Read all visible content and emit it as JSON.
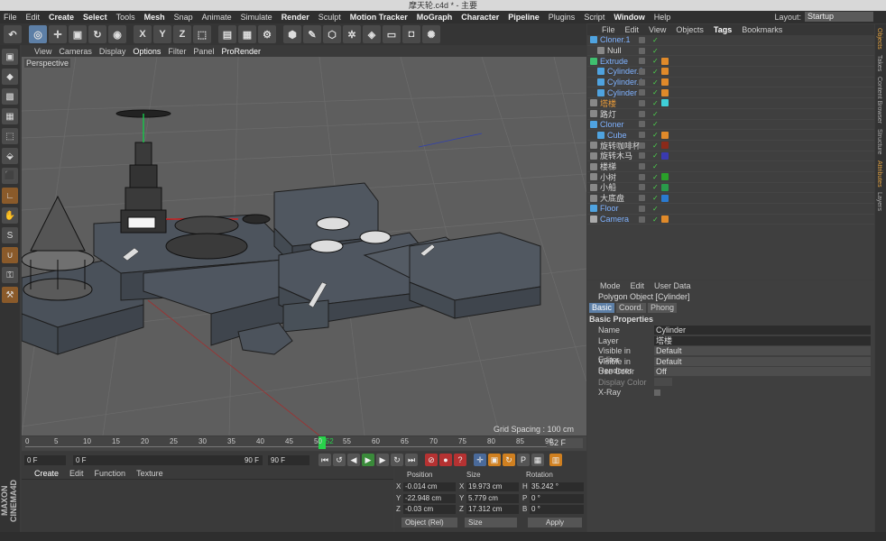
{
  "window": {
    "title": "摩天轮.c4d * - 主要"
  },
  "menu": [
    "File",
    "Edit",
    "Create",
    "Select",
    "Tools",
    "Mesh",
    "Snap",
    "Animate",
    "Simulate",
    "Render",
    "Sculpt",
    "Motion Tracker",
    "MoGraph",
    "Character",
    "Pipeline",
    "Plugins",
    "Script",
    "Window",
    "Help"
  ],
  "layout": {
    "label": "Layout:",
    "value": "Startup"
  },
  "toolbar": {
    "undo_icon": "undo-icon",
    "axis": [
      "X",
      "Y",
      "Z"
    ]
  },
  "viewport": {
    "menu": [
      "View",
      "Cameras",
      "Display",
      "Options",
      "Filter",
      "Panel",
      "ProRender"
    ],
    "label": "Perspective",
    "grid_spacing": "Grid Spacing : 100 cm"
  },
  "timeline": {
    "ticks": [
      "0",
      "5",
      "10",
      "15",
      "20",
      "25",
      "30",
      "35",
      "40",
      "45",
      "50",
      "52",
      "55",
      "60",
      "65",
      "70",
      "75",
      "80",
      "85",
      "90"
    ],
    "current_frame": 52,
    "max_frame": 90,
    "frame_display": "52 F"
  },
  "transport": {
    "start": "0 F",
    "range_start": "0 F",
    "range_end": "90 F",
    "end": "90 F"
  },
  "material": {
    "menu": [
      "Create",
      "Edit",
      "Function",
      "Texture"
    ]
  },
  "coordinates": {
    "headers": [
      "Position",
      "Size",
      "Rotation"
    ],
    "rows": [
      {
        "axis": "X",
        "pos": "-0.014 cm",
        "size_axis": "X",
        "size": "19.973 cm",
        "rot_axis": "H",
        "rot": "35.242 °"
      },
      {
        "axis": "Y",
        "pos": "-22.948 cm",
        "size_axis": "Y",
        "size": "5.779 cm",
        "rot_axis": "P",
        "rot": "0 °"
      },
      {
        "axis": "Z",
        "pos": "-0.03 cm",
        "size_axis": "Z",
        "size": "17.312 cm",
        "rot_axis": "B",
        "rot": "0 °"
      }
    ],
    "mode": "Object (Rel)",
    "size_mode": "Size",
    "apply": "Apply"
  },
  "objects": {
    "menu": [
      "File",
      "Edit",
      "View",
      "Objects",
      "Tags",
      "Bookmarks"
    ],
    "items": [
      {
        "name": "Cloner.1",
        "indent": 0,
        "color": "blue",
        "icon": "#4fa3e0",
        "tag": ""
      },
      {
        "name": "Null",
        "indent": 1,
        "color": "white",
        "icon": "#888888",
        "tag": ""
      },
      {
        "name": "Extrude",
        "indent": 0,
        "color": "blue",
        "icon": "#3fbf6f",
        "tag": "#e08a2a"
      },
      {
        "name": "Cylinder.2",
        "indent": 1,
        "color": "blue",
        "icon": "#4fa3e0",
        "tag": "#e08a2a"
      },
      {
        "name": "Cylinder.1",
        "indent": 1,
        "color": "blue",
        "icon": "#4fa3e0",
        "tag": "#e08a2a"
      },
      {
        "name": "Cylinder",
        "indent": 1,
        "color": "blue",
        "icon": "#4fa3e0",
        "tag": "#e08a2a"
      },
      {
        "name": "塔楼",
        "indent": 0,
        "color": "orange",
        "icon": "#888888",
        "tag": "#3fd0d8"
      },
      {
        "name": "路灯",
        "indent": 0,
        "color": "white",
        "icon": "#888888",
        "tag": ""
      },
      {
        "name": "Cloner",
        "indent": 0,
        "color": "blue",
        "icon": "#4fa3e0",
        "tag": ""
      },
      {
        "name": "Cube",
        "indent": 1,
        "color": "blue",
        "icon": "#4fa3e0",
        "tag": "#e08a2a"
      },
      {
        "name": "旋转咖啡杯",
        "indent": 0,
        "color": "white",
        "icon": "#888888",
        "tag": "#8a2a1a"
      },
      {
        "name": "旋转木马",
        "indent": 0,
        "color": "white",
        "icon": "#888888",
        "tag": "#3a3ab0"
      },
      {
        "name": "楼梯",
        "indent": 0,
        "color": "white",
        "icon": "#888888",
        "tag": ""
      },
      {
        "name": "小树",
        "indent": 0,
        "color": "white",
        "icon": "#888888",
        "tag": "#2aa02a"
      },
      {
        "name": "小船",
        "indent": 0,
        "color": "white",
        "icon": "#888888",
        "tag": "#2a9a4a"
      },
      {
        "name": "大底盘",
        "indent": 0,
        "color": "white",
        "icon": "#888888",
        "tag": "#2a7ad0"
      },
      {
        "name": "Floor",
        "indent": 0,
        "color": "blue",
        "icon": "#4fa3e0",
        "tag": ""
      },
      {
        "name": "Camera",
        "indent": 0,
        "color": "blue",
        "icon": "#aaaaaa",
        "tag": "#e08a2a"
      }
    ]
  },
  "attributes": {
    "menu": [
      "Mode",
      "Edit",
      "User Data"
    ],
    "title": "Polygon Object [Cylinder]",
    "tabs": [
      "Basic",
      "Coord.",
      "Phong"
    ],
    "section": "Basic Properties",
    "rows": [
      {
        "label": "Name",
        "value": "Cylinder",
        "type": "text"
      },
      {
        "label": "Layer",
        "value": "塔楼",
        "type": "text"
      },
      {
        "label": "Visible in Editor",
        "value": "Default",
        "type": "dropdown"
      },
      {
        "label": "Visible in Renderer",
        "value": "Default",
        "type": "dropdown"
      },
      {
        "label": "Use Color",
        "value": "Off",
        "type": "dropdown"
      },
      {
        "label": "Display Color",
        "value": "",
        "type": "dim"
      },
      {
        "label": "X-Ray",
        "value": "",
        "type": "check"
      }
    ]
  },
  "right_tabs": [
    "Objects",
    "Takes",
    "Content Browser",
    "Structure",
    "Attributes",
    "Layers"
  ]
}
